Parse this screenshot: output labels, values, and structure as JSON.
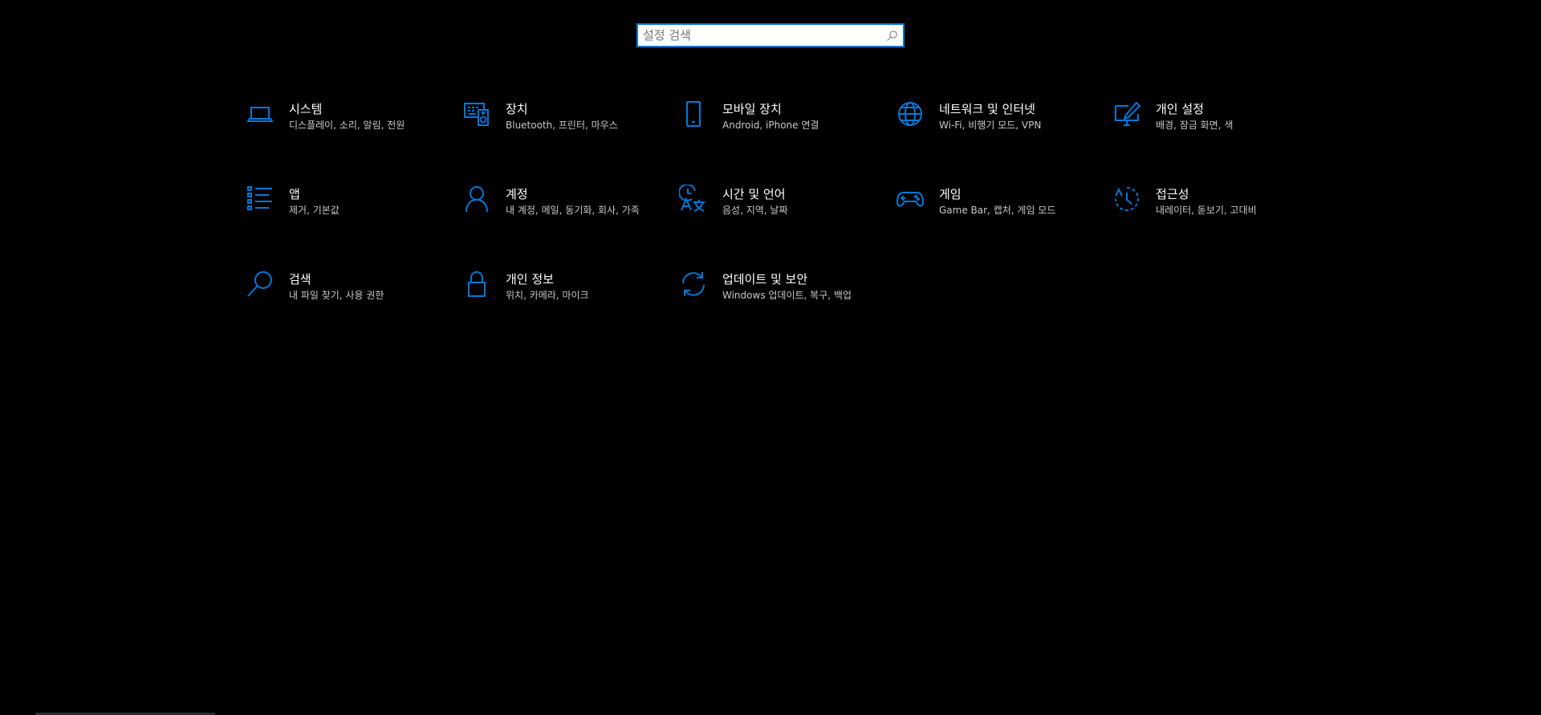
{
  "search": {
    "placeholder": "설정 검색",
    "value": ""
  },
  "accent_color": "#0078d7",
  "tiles": [
    {
      "title": "시스템",
      "desc": "디스플레이, 소리, 알림, 전원",
      "icon": "laptop-icon"
    },
    {
      "title": "장치",
      "desc": "Bluetooth, 프린터, 마우스",
      "icon": "devices-icon"
    },
    {
      "title": "모바일 장치",
      "desc": "Android, iPhone 연결",
      "icon": "phone-icon"
    },
    {
      "title": "네트워크 및 인터넷",
      "desc": "Wi-Fi, 비행기 모드, VPN",
      "icon": "globe-icon"
    },
    {
      "title": "개인 설정",
      "desc": "배경, 잠금 화면, 색",
      "icon": "personalization-icon"
    },
    {
      "title": "앱",
      "desc": "제거, 기본값",
      "icon": "apps-list-icon"
    },
    {
      "title": "계정",
      "desc": "내 계정, 메일, 동기화, 회사, 가족",
      "icon": "person-icon"
    },
    {
      "title": "시간 및 언어",
      "desc": "음성, 지역, 날짜",
      "icon": "time-language-icon"
    },
    {
      "title": "게임",
      "desc": "Game Bar, 캡처, 게임 모드",
      "icon": "gamepad-icon"
    },
    {
      "title": "접근성",
      "desc": "내레이터, 돋보기, 고대비",
      "icon": "ease-of-access-icon"
    },
    {
      "title": "검색",
      "desc": "내 파일 찾기, 사용 권한",
      "icon": "search-icon"
    },
    {
      "title": "개인 정보",
      "desc": "위치, 카메라, 마이크",
      "icon": "lock-icon"
    },
    {
      "title": "업데이트 및 보안",
      "desc": "Windows 업데이트, 복구, 백업",
      "icon": "sync-icon"
    }
  ]
}
